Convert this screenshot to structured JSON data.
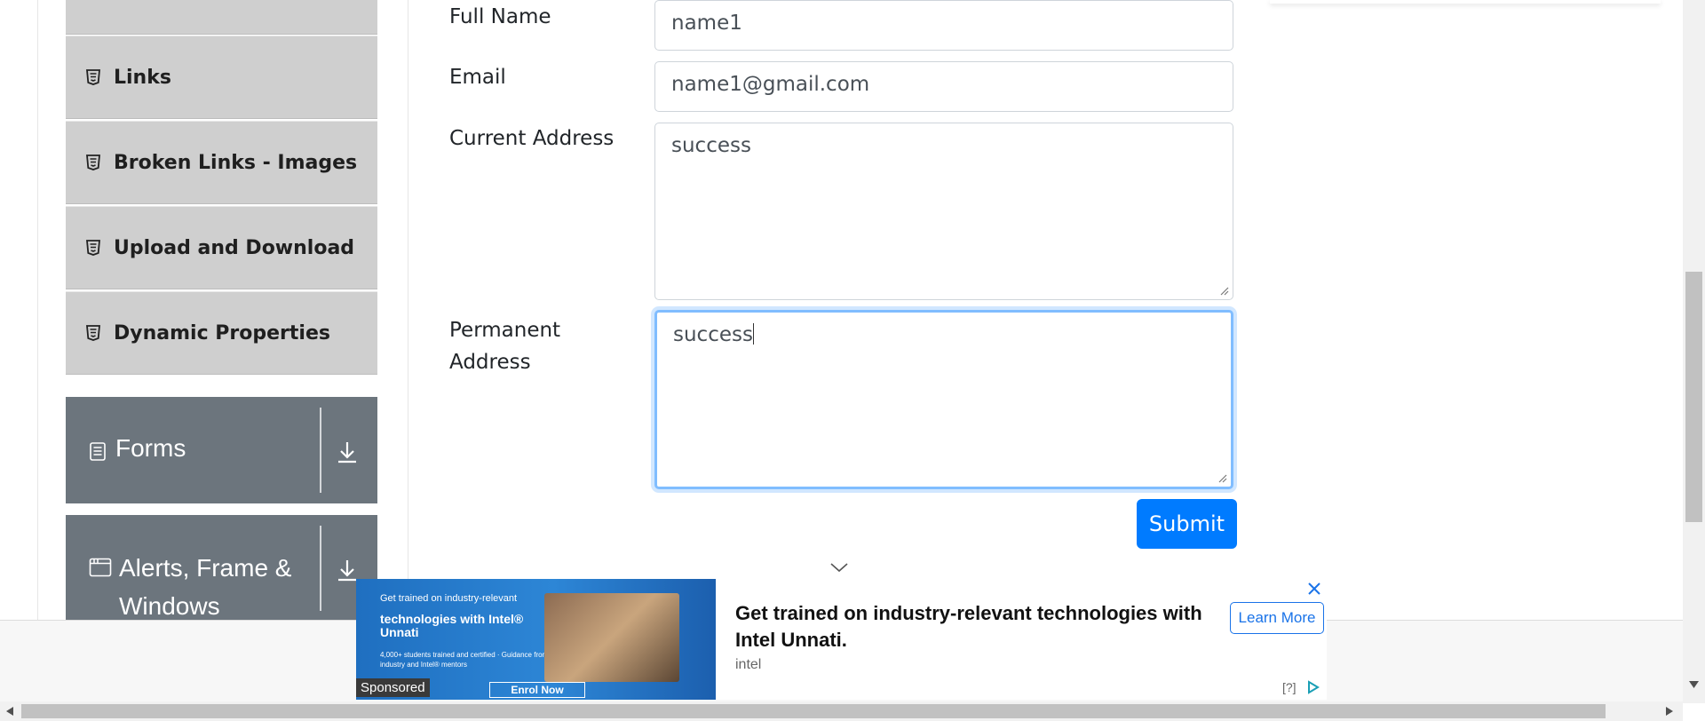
{
  "sidebar": {
    "items": [
      {
        "label": "Links",
        "icon": "html5-icon"
      },
      {
        "label": "Broken Links - Images",
        "icon": "html5-icon"
      },
      {
        "label": "Upload and Download",
        "icon": "html5-icon"
      },
      {
        "label": "Dynamic Properties",
        "icon": "html5-icon"
      }
    ],
    "groups": [
      {
        "title": "Forms",
        "icon": "document-icon",
        "action_icon": "download-icon"
      },
      {
        "title_line1": "Alerts, Frame &",
        "title_line2": "Windows",
        "icon": "window-icon",
        "action_icon": "download-icon"
      }
    ]
  },
  "form": {
    "full_name": {
      "label": "Full Name",
      "value": "name1"
    },
    "email": {
      "label": "Email",
      "value": "name1@gmail.com"
    },
    "current_address": {
      "label": "Current Address",
      "value": "success"
    },
    "permanent_address": {
      "label_line1": "Permanent",
      "label_line2": "Address",
      "value": "success"
    },
    "submit_label": "Submit"
  },
  "ad": {
    "image_text_small": "Get trained on industry-relevant",
    "image_text_bold": "technologies with Intel® Unnati",
    "image_text_detail": "4,000+ students trained and certified · Guidance from industry and Intel® mentors",
    "image_button": "Enrol Now",
    "sponsored_label": "Sponsored",
    "headline": "Get trained on industry-relevant technologies with Intel Unnati.",
    "brand": "intel",
    "cta_label": "Learn More",
    "info_label": "[?]"
  },
  "colors": {
    "accent": "#007bff",
    "group_bg": "#6c757d",
    "item_bg": "#cfcfcf"
  }
}
